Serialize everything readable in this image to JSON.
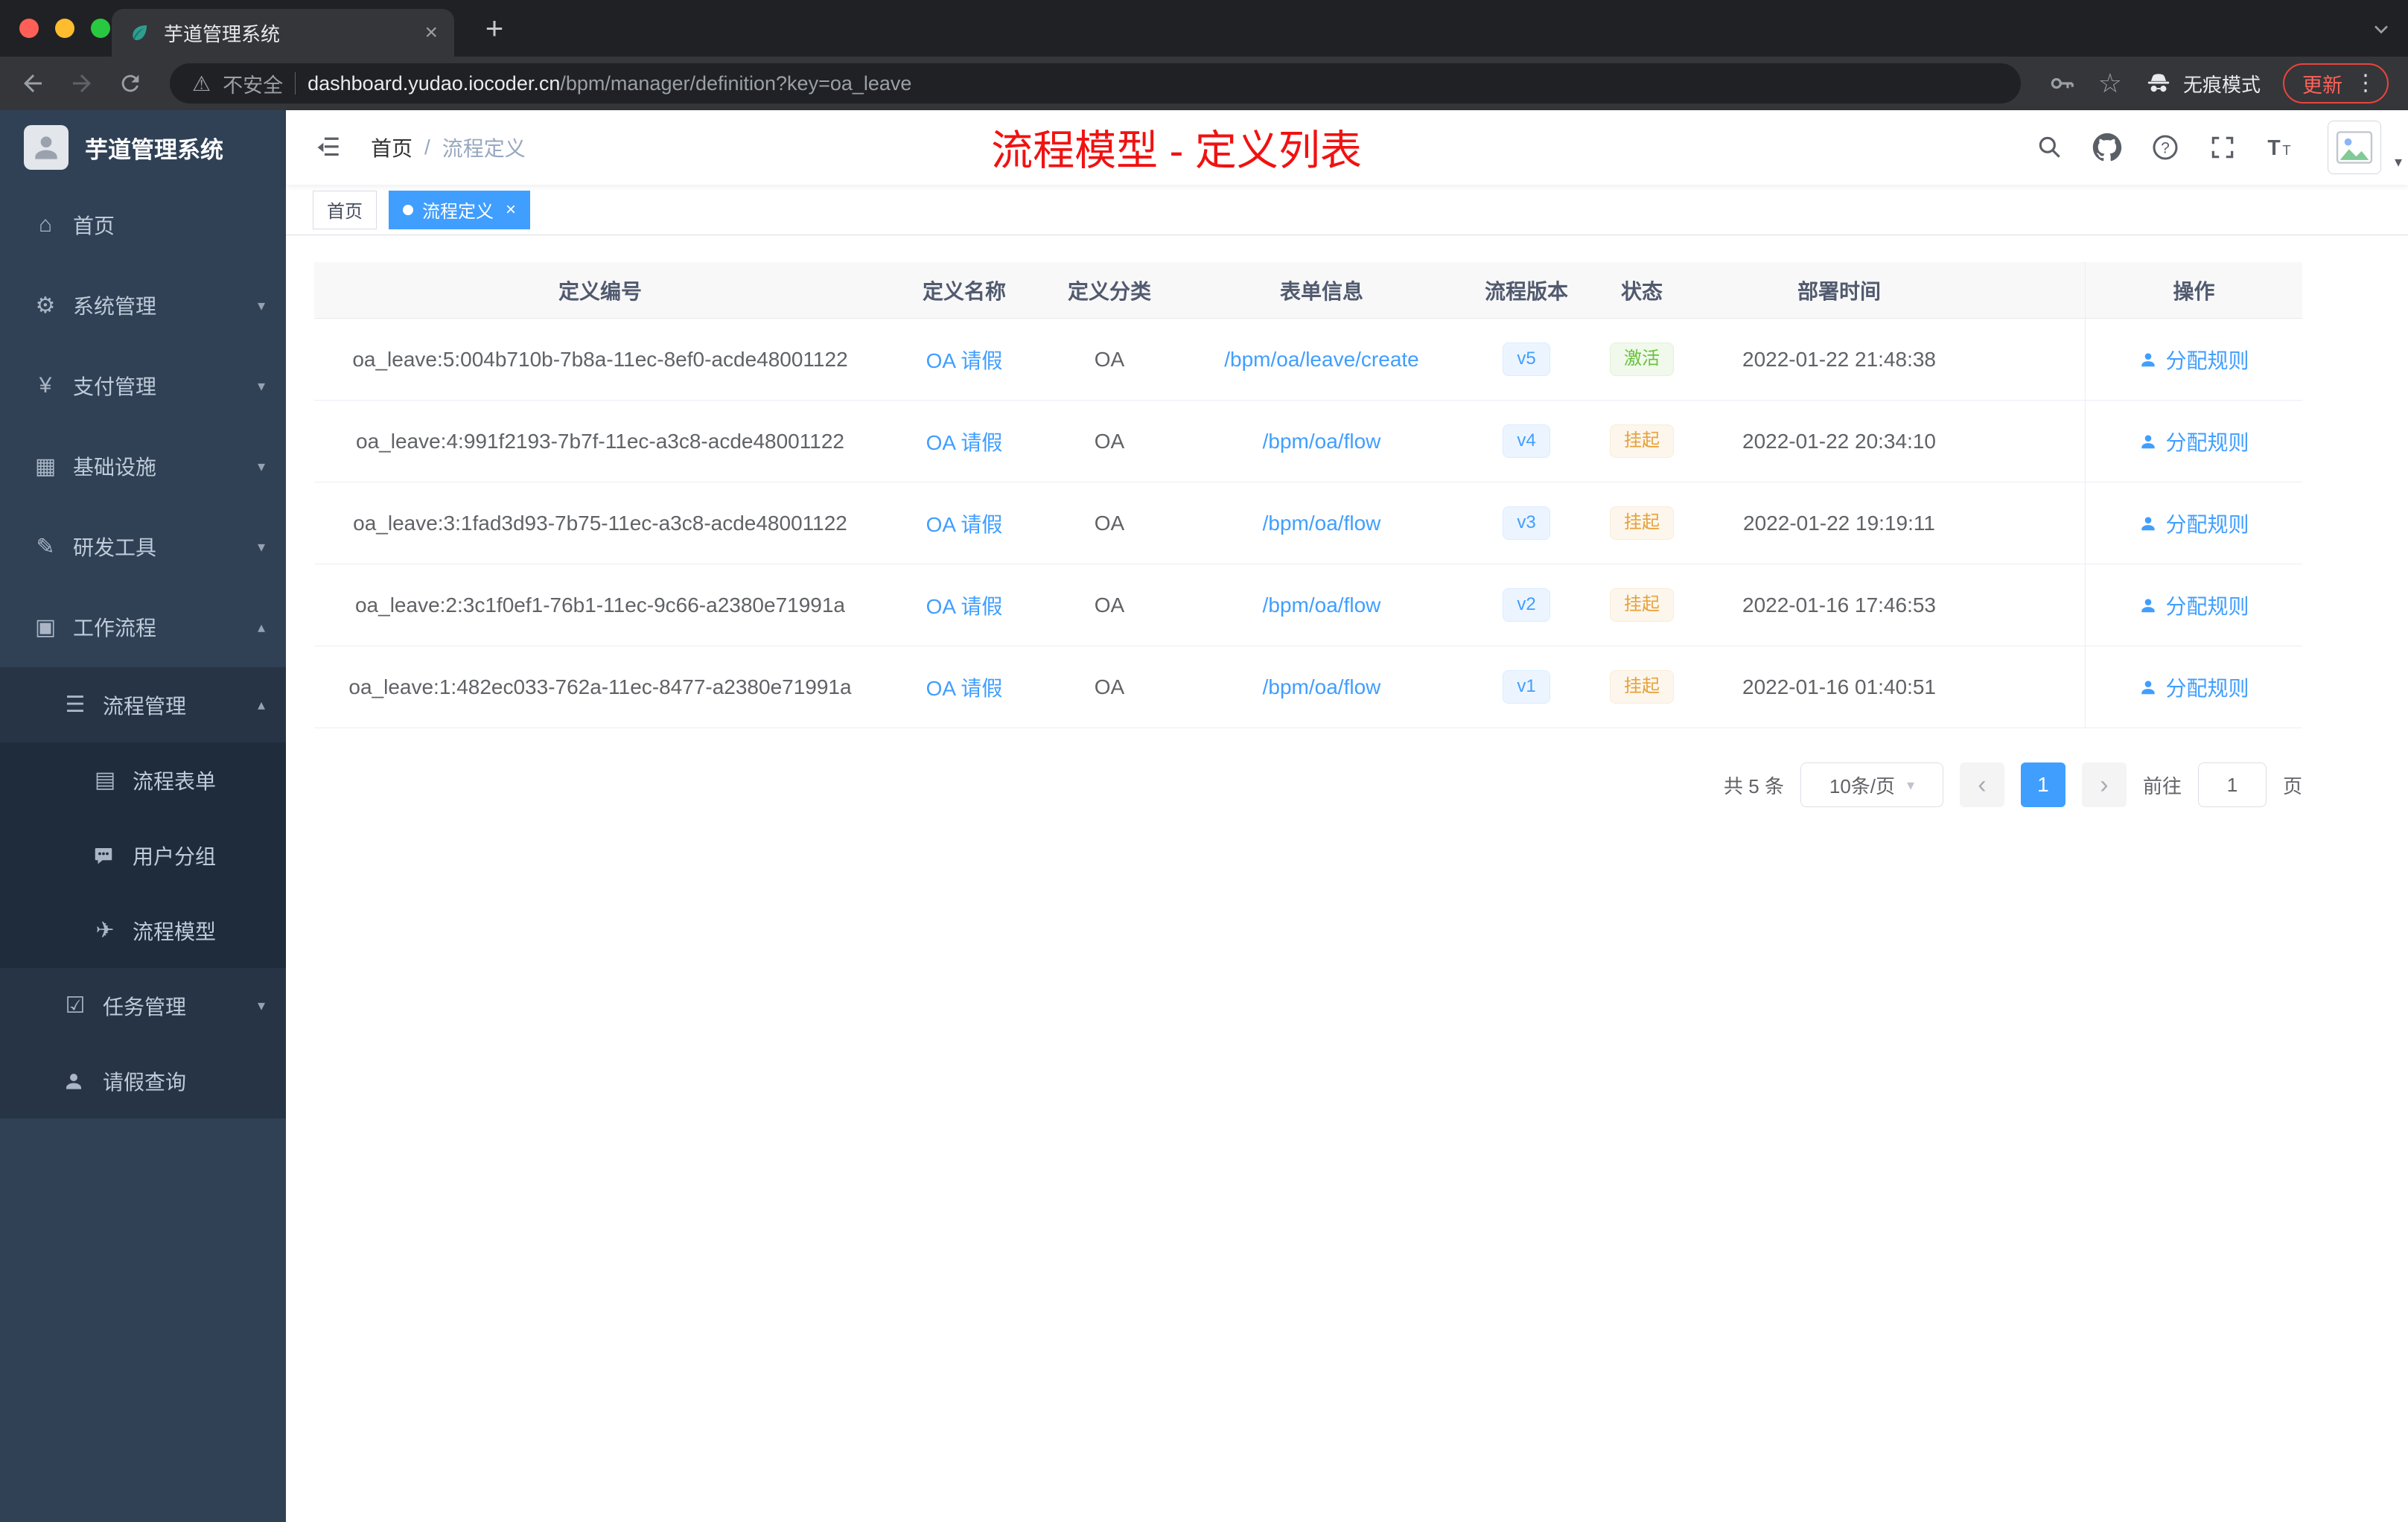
{
  "browser": {
    "tab_title": "芋道管理系统",
    "not_secure": "不安全",
    "url_domain": "dashboard.yudao.iocoder.cn",
    "url_path": "/bpm/manager/definition?key=oa_leave",
    "incognito": "无痕模式",
    "update": "更新"
  },
  "sidebar": {
    "title": "芋道管理系统",
    "items": [
      {
        "label": "首页",
        "icon": "dashboard-icon"
      },
      {
        "label": "系统管理",
        "icon": "gear-icon"
      },
      {
        "label": "支付管理",
        "icon": "yen-icon"
      },
      {
        "label": "基础设施",
        "icon": "infrastructure-icon"
      },
      {
        "label": "研发工具",
        "icon": "dev-tools-icon"
      },
      {
        "label": "工作流程",
        "icon": "workflow-icon",
        "expanded": true,
        "children": [
          {
            "label": "流程管理",
            "icon": "list-icon",
            "expanded": true,
            "children": [
              {
                "label": "流程表单",
                "icon": "form-icon"
              },
              {
                "label": "用户分组",
                "icon": "user-group-icon"
              },
              {
                "label": "流程模型",
                "icon": "paper-plane-icon"
              }
            ]
          },
          {
            "label": "任务管理",
            "icon": "task-icon"
          },
          {
            "label": "请假查询",
            "icon": "person-icon"
          }
        ]
      }
    ]
  },
  "navbar": {
    "breadcrumb_home": "首页",
    "breadcrumb_sep": "/",
    "breadcrumb_current": "流程定义",
    "banner": "流程模型 - 定义列表"
  },
  "tags": {
    "home": "首页",
    "active": "流程定义"
  },
  "table": {
    "columns": [
      "定义编号",
      "定义名称",
      "定义分类",
      "表单信息",
      "流程版本",
      "状态",
      "部署时间",
      "操作"
    ],
    "rows": [
      {
        "id": "oa_leave:5:004b710b-7b8a-11ec-8ef0-acde48001122",
        "name": "OA 请假",
        "category": "OA",
        "form": "/bpm/oa/leave/create",
        "version": "v5",
        "status": "激活",
        "status_type": "success",
        "time": "2022-01-22 21:48:38",
        "action": "分配规则"
      },
      {
        "id": "oa_leave:4:991f2193-7b7f-11ec-a3c8-acde48001122",
        "name": "OA 请假",
        "category": "OA",
        "form": "/bpm/oa/flow",
        "version": "v4",
        "status": "挂起",
        "status_type": "warning",
        "time": "2022-01-22 20:34:10",
        "action": "分配规则"
      },
      {
        "id": "oa_leave:3:1fad3d93-7b75-11ec-a3c8-acde48001122",
        "name": "OA 请假",
        "category": "OA",
        "form": "/bpm/oa/flow",
        "version": "v3",
        "status": "挂起",
        "status_type": "warning",
        "time": "2022-01-22 19:19:11",
        "action": "分配规则"
      },
      {
        "id": "oa_leave:2:3c1f0ef1-76b1-11ec-9c66-a2380e71991a",
        "name": "OA 请假",
        "category": "OA",
        "form": "/bpm/oa/flow",
        "version": "v2",
        "status": "挂起",
        "status_type": "warning",
        "time": "2022-01-16 17:46:53",
        "action": "分配规则"
      },
      {
        "id": "oa_leave:1:482ec033-762a-11ec-8477-a2380e71991a",
        "name": "OA 请假",
        "category": "OA",
        "form": "/bpm/oa/flow",
        "version": "v1",
        "status": "挂起",
        "status_type": "warning",
        "time": "2022-01-16 01:40:51",
        "action": "分配规则"
      }
    ]
  },
  "pagination": {
    "total": "共 5 条",
    "page_size": "10条/页",
    "page": "1",
    "goto": "前往",
    "unit": "页",
    "goto_value": "1"
  },
  "colors": {
    "accent": "#409EFF",
    "success": "#67C23A",
    "warning": "#E6A23C",
    "banner_red": "#F01212",
    "sidebar_bg": "#304156"
  }
}
